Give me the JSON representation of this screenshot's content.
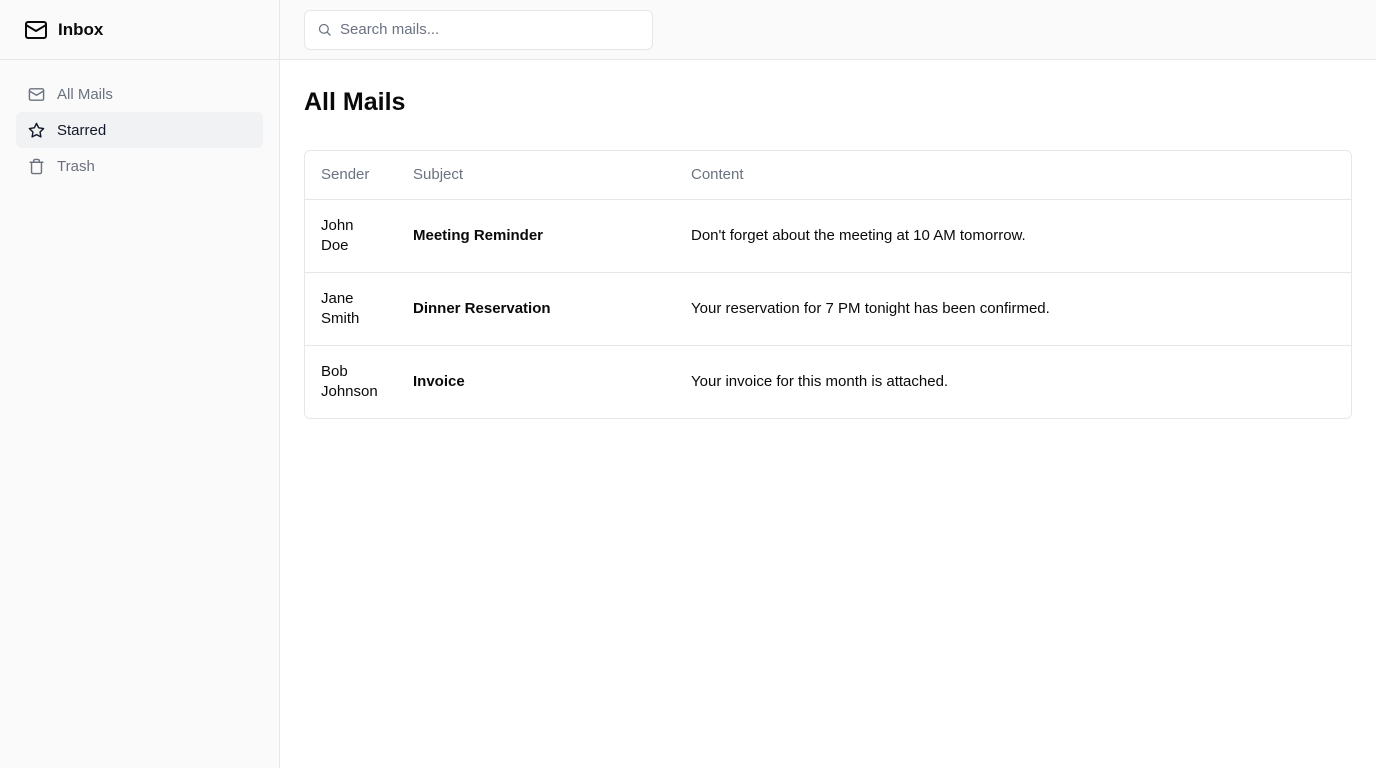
{
  "sidebar": {
    "brand": {
      "title": "Inbox",
      "icon": "mail-icon"
    },
    "items": [
      {
        "label": "All Mails",
        "icon": "mail-icon",
        "active": false
      },
      {
        "label": "Starred",
        "icon": "star-icon",
        "active": true
      },
      {
        "label": "Trash",
        "icon": "trash-icon",
        "active": false
      }
    ]
  },
  "search": {
    "placeholder": "Search mails...",
    "value": "",
    "icon": "search-icon"
  },
  "main": {
    "title": "All Mails",
    "table": {
      "headers": [
        "Sender",
        "Subject",
        "Content"
      ],
      "rows": [
        {
          "sender": "John Doe",
          "subject": "Meeting Reminder",
          "content": "Don't forget about the meeting at 10 AM tomorrow."
        },
        {
          "sender": "Jane Smith",
          "subject": "Dinner Reservation",
          "content": "Your reservation for 7 PM tonight has been confirmed."
        },
        {
          "sender": "Bob Johnson",
          "subject": "Invoice",
          "content": "Your invoice for this month is attached."
        }
      ]
    }
  },
  "colors": {
    "sidebar_bg": "#fafafa",
    "active_item_bg": "#f1f2f4",
    "border": "#e5e7eb",
    "muted_text": "#6b7280",
    "text": "#0a0a0a"
  }
}
